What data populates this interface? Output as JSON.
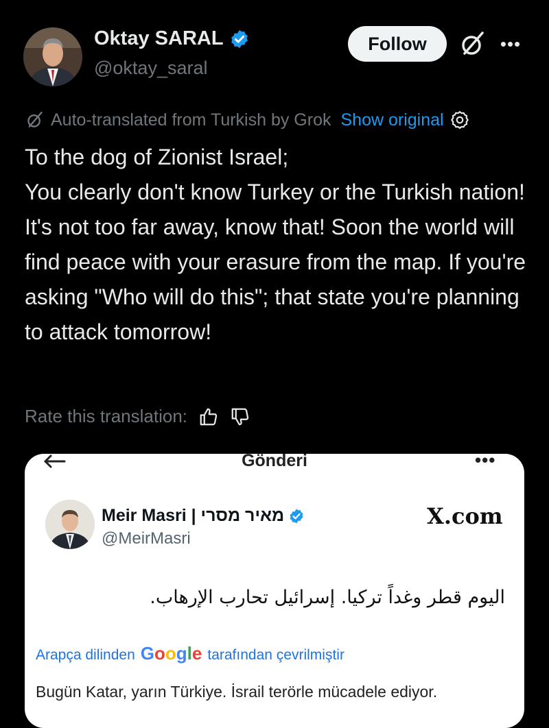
{
  "author": {
    "name": "Oktay SARAL",
    "handle": "@oktay_saral",
    "verified": true,
    "verified_color": "#1d9bf0"
  },
  "actions": {
    "follow_label": "Follow",
    "more_icon": "more-horizontal-icon",
    "grok_icon": "grok-icon"
  },
  "translation_bar": {
    "text": "Auto-translated from Turkish by Grok",
    "show_original": "Show original",
    "settings_icon": "gear-icon"
  },
  "tweet": {
    "lines": [
      "To the dog of Zionist Israel;",
      "You clearly don't know Turkey or the Turkish nation! It's not too far away, know that! Soon the world will find peace with your erasure from the map. If you're asking \"Who will do this\"; that state you're planning to attack tomorrow!"
    ]
  },
  "rate": {
    "label": "Rate this translation:",
    "up_icon": "thumbs-up-icon",
    "down_icon": "thumbs-down-icon"
  },
  "embedded_image": {
    "header_title": "Gönderi",
    "back_icon": "arrow-left-icon",
    "more_icon": "more-horizontal-icon",
    "author_name": "Meir Masri | מאיר מסרי",
    "author_handle": "@MeirMasri",
    "verified": true,
    "watermark": "X.com",
    "original_text": "اليوم قطر وغداً تركيا. إسرائيل تحارب الإرهاب.",
    "translated_prefix": "Arapça dilinden",
    "google": "Google",
    "translated_suffix": "tarafından çevrilmiştir",
    "translation": "Bugün Katar, yarın Türkiye. İsrail terörle mücadele ediyor."
  }
}
